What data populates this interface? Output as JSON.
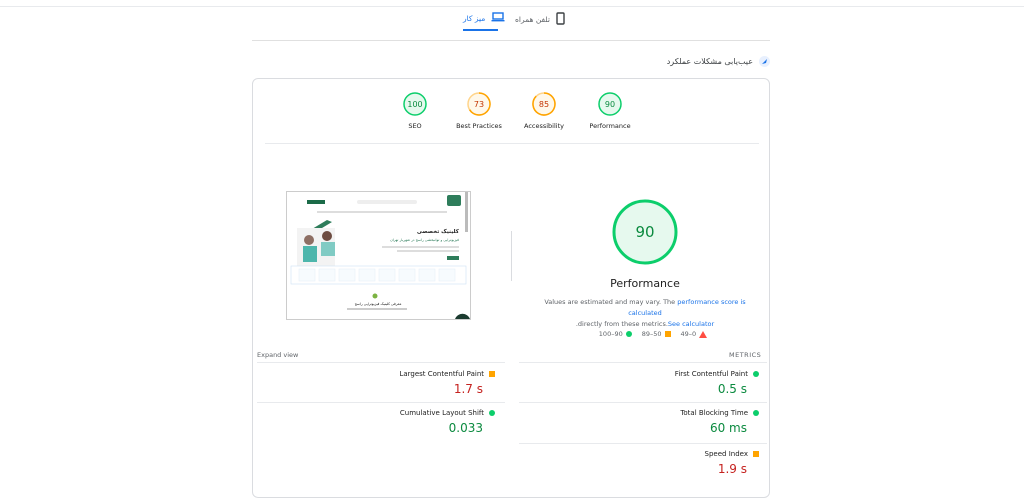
{
  "tabs": {
    "desktop": "میز کار",
    "mobile": "تلفن همراه"
  },
  "diagnose": {
    "label": "عیب‌یابی مشکلات عملکرد"
  },
  "categories": [
    {
      "label": "SEO",
      "score": "100",
      "color": "#0cce6b"
    },
    {
      "label": "Best Practices",
      "score": "73",
      "color": "#ffa400"
    },
    {
      "label": "Accessibility",
      "score": "85",
      "color": "#ffa400"
    },
    {
      "label": "Performance",
      "score": "90",
      "color": "#0cce6b"
    }
  ],
  "performance": {
    "score": "90",
    "title": "Performance",
    "desc_pre": "Values are estimated and may vary. The ",
    "desc_link": "performance score is calculated",
    "desc_mid": "directly from these metrics.",
    "desc_link2": "See calculator",
    "desc_end": "."
  },
  "legend": {
    "good": "100–90",
    "avg": "89–50",
    "poor": "49–0"
  },
  "expand_label": "Expand view",
  "metrics_heading": "METRICS",
  "metrics": [
    {
      "name": "First Contentful Paint",
      "value": "0.5 s",
      "status": "good"
    },
    {
      "name": "Largest Contentful Paint",
      "value": "1.7 s",
      "status": "avg"
    },
    {
      "name": "Total Blocking Time",
      "value": "60 ms",
      "status": "good"
    },
    {
      "name": "Cumulative Layout Shift",
      "value": "0.033",
      "status": "good"
    },
    {
      "name": "Speed Index",
      "value": "1.9 s",
      "status": "avg"
    }
  ],
  "thumbnail": {
    "headline": "کلینیک تخصصی",
    "subline": "فیزیوتراپی و توانبخشی راسخ در شهریار تهران",
    "bottom_title": "معرفی کلینیک فیزیوتراپی راسخ"
  },
  "colors": {
    "good": "#0cce6b",
    "average": "#ffa400",
    "poor": "#ff4e42",
    "link": "#1a73e8"
  }
}
